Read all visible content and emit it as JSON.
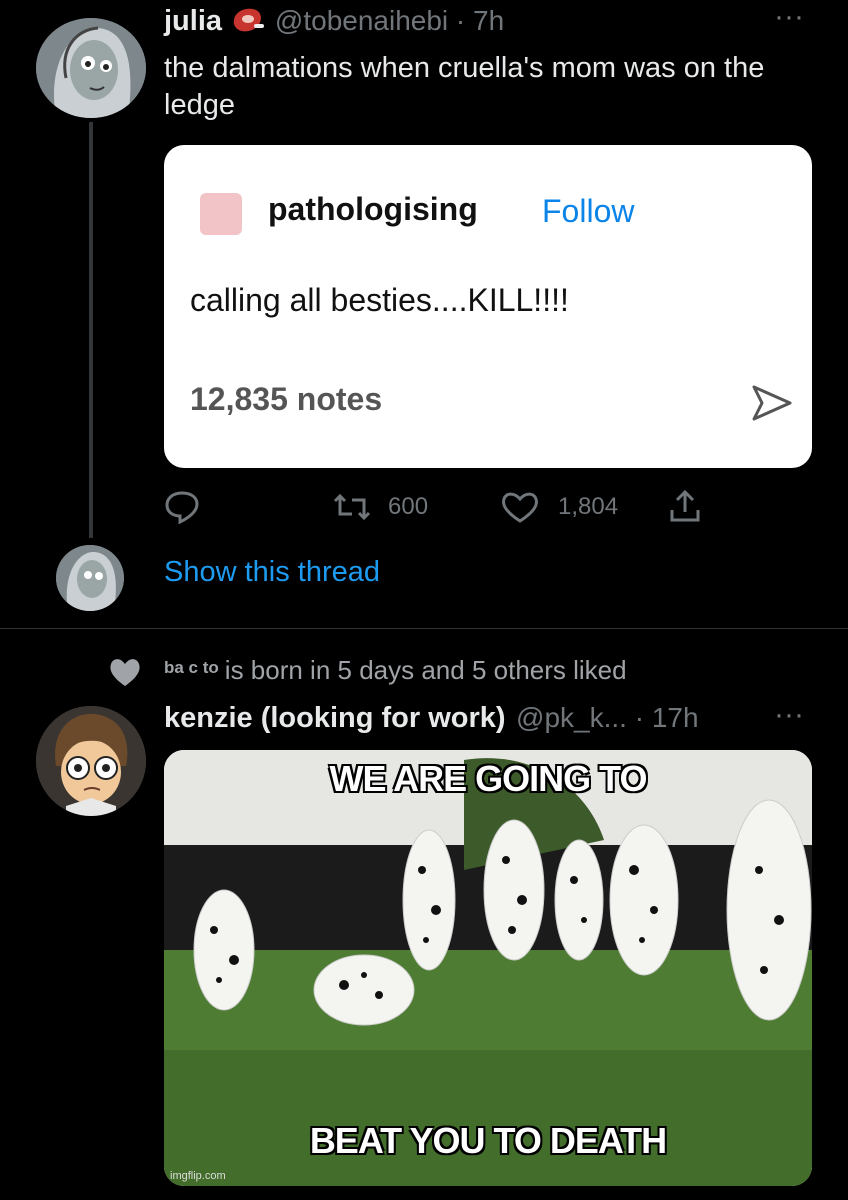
{
  "tweet1": {
    "name": "julia",
    "emoji": "meat-emoji",
    "handle_time": "@tobenaihebi · 7h",
    "text": "the dalmations when cruella's mom was on the ledge",
    "more": "···",
    "card": {
      "username": "pathologising",
      "follow": "Follow",
      "post": "calling all besties....KILL!!!!",
      "notes": "12,835 notes"
    },
    "actions": {
      "retweets": "600",
      "likes": "1,804"
    },
    "show_thread": "Show this thread"
  },
  "social_context": {
    "small": "ba c to",
    "text": "is born in 5 days and 5 others liked"
  },
  "tweet2": {
    "name": "kenzie (looking for work)",
    "handle_time": "@pk_k... · 17h",
    "more": "···",
    "meme_top": "WE ARE GOING TO",
    "meme_bottom": "BEAT YOU TO DEATH",
    "watermark": "imgflip.com"
  },
  "colors": {
    "background": "#000000",
    "link": "#1d9bf0",
    "muted": "#71767b",
    "follow": "#0a84e8"
  }
}
